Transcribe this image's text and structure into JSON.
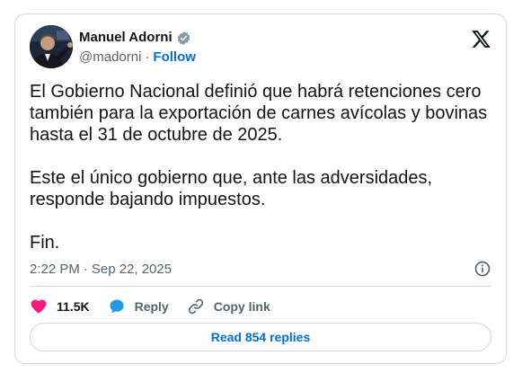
{
  "author": {
    "name": "Manuel Adorni",
    "handle": "@madorni",
    "separator": "·",
    "follow_label": "Follow",
    "verified_badge_color": "#829aab"
  },
  "tweet": {
    "paragraphs": [
      "El Gobierno Nacional definió que habrá retenciones cero también para la exportación de carnes avícolas y bovinas hasta el 31 de octubre de 2025.",
      "Este el único gobierno que, ante las adversidades, responde bajando impuestos.",
      "Fin."
    ],
    "time": "2:22 PM",
    "date": "Sep 22, 2025",
    "meta_separator": "·"
  },
  "actions": {
    "likes": "11.5K",
    "reply_label": "Reply",
    "copy_link_label": "Copy link",
    "read_replies_label": "Read 854 replies"
  },
  "icons": {
    "platform": "x-logo-icon",
    "verified": "verified-badge-icon",
    "info": "info-icon",
    "like": "heart-icon",
    "reply": "speech-bubble-icon",
    "copy": "link-icon"
  },
  "colors": {
    "like": "#f91880",
    "reply": "#1d9bf0",
    "link": "#006fd6",
    "muted": "#536471",
    "border": "#cfd9de"
  }
}
